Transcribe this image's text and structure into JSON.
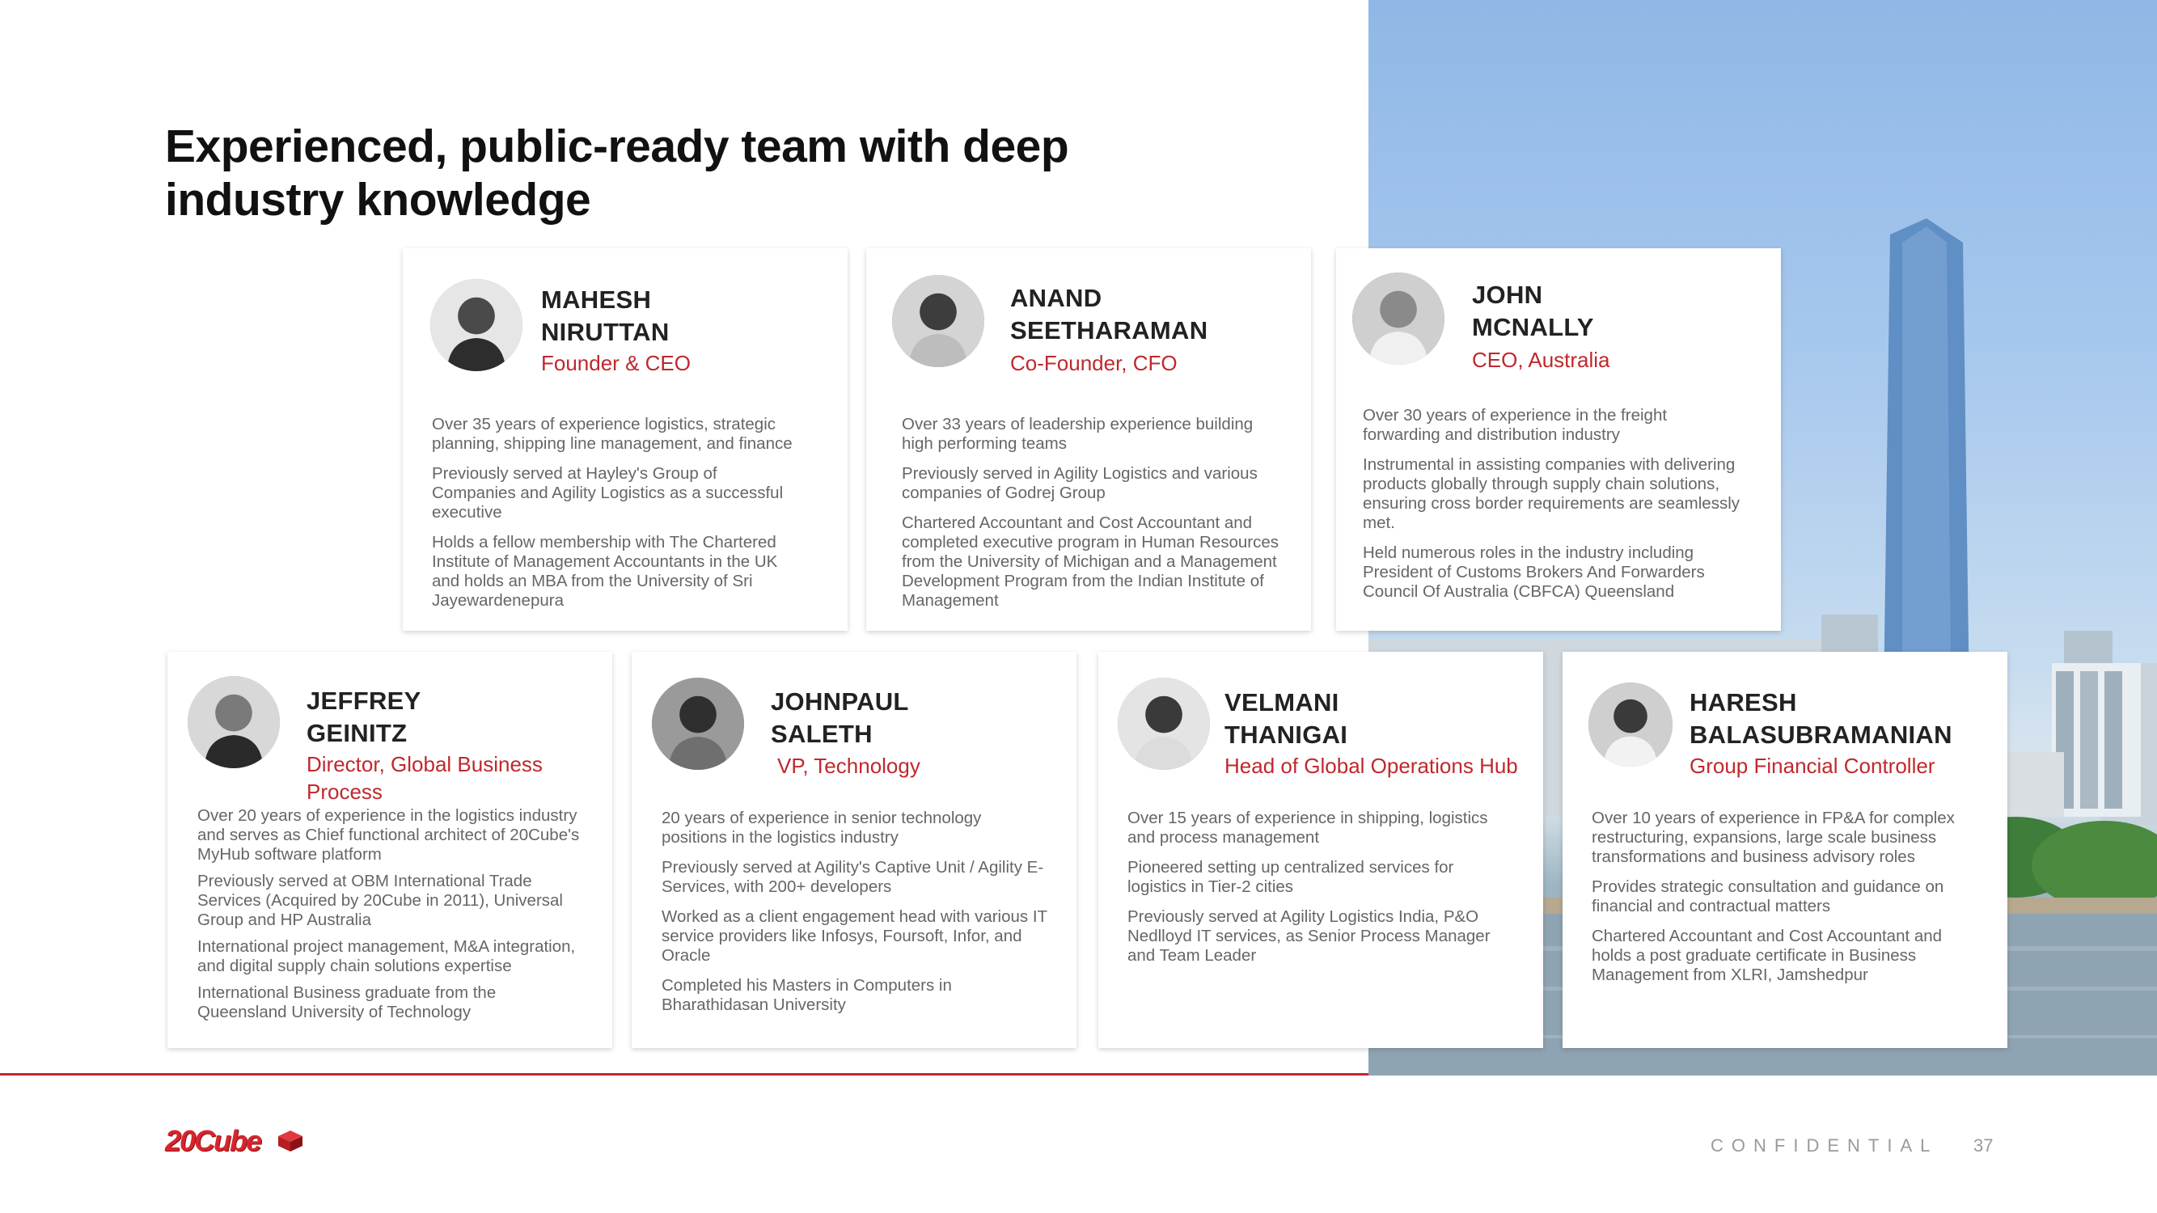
{
  "title": "Experienced, public-ready team with deep industry knowledge",
  "team": [
    {
      "name_line1": "MAHESH",
      "name_line2": "NIRUTTAN",
      "role": "Founder & CEO",
      "bullets": [
        "Over 35 years of experience logistics, strategic planning, shipping line management, and finance",
        "Previously served at Hayley's Group of Companies and Agility Logistics as a successful executive",
        "Holds a fellow membership with The Chartered Institute of Management Accountants in the UK and holds an MBA from the University of Sri Jayewardenepura"
      ]
    },
    {
      "name_line1": "ANAND",
      "name_line2": "SEETHARAMAN",
      "role": "Co-Founder, CFO",
      "bullets": [
        "Over 33 years of leadership experience building high performing teams",
        "Previously served in Agility Logistics and various companies of Godrej Group",
        "Chartered Accountant and Cost Accountant and completed executive program in Human Resources from the University of Michigan and a Management Development Program from the Indian Institute of Management"
      ]
    },
    {
      "name_line1": "JOHN",
      "name_line2": "MCNALLY",
      "role": "CEO, Australia",
      "bullets": [
        "Over 30 years of experience in the freight forwarding and distribution industry",
        "Instrumental in assisting companies with delivering products globally through supply chain solutions, ensuring cross border requirements are seamlessly met.",
        "Held numerous roles in the industry including President of Customs Brokers And Forwarders Council Of Australia (CBFCA) Queensland"
      ]
    },
    {
      "name_line1": "JEFFREY",
      "name_line2": "GEINITZ",
      "role": "Director, Global Business Process",
      "bullets": [
        "Over 20 years of experience in the logistics industry and serves as Chief functional architect of 20Cube's MyHub software platform",
        "Previously served at OBM International Trade Services (Acquired by 20Cube in 2011), Universal Group and HP Australia",
        "International project management, M&A integration, and digital supply chain solutions expertise",
        "International Business graduate from the Queensland University of Technology"
      ]
    },
    {
      "name_line1": "JOHNPAUL",
      "name_line2": "SALETH",
      "role": "VP, Technology",
      "bullets": [
        "20 years of experience in senior technology positions in the logistics industry",
        "Previously served at Agility's Captive Unit / Agility E-Services, with 200+ developers",
        "Worked as a client engagement head with various IT service providers like Infosys, Foursoft, Infor, and Oracle",
        "Completed his Masters in Computers in Bharathidasan University"
      ]
    },
    {
      "name_line1": "VELMANI",
      "name_line2": "THANIGAI",
      "role": "Head of Global Operations Hub",
      "bullets": [
        "Over 15 years of experience in shipping, logistics and process management",
        "Pioneered setting up centralized services for logistics in Tier-2 cities",
        "Previously served at Agility Logistics India, P&O Nedlloyd IT services, as Senior Process Manager and Team Leader"
      ]
    },
    {
      "name_line1": "HARESH",
      "name_line2": "BALASUBRAMANIAN",
      "role": "Group Financial Controller",
      "bullets": [
        "Over 10 years of experience in FP&A for complex restructuring, expansions, large scale business transformations and business advisory roles",
        "Provides strategic consultation and guidance on financial and contractual matters",
        "Chartered Accountant and Cost Accountant and holds a post graduate certificate in Business Management from XLRI, Jamshedpur"
      ]
    }
  ],
  "footer": {
    "logo_text": "20Cube",
    "confidential": "CONFIDENTIAL",
    "page_number": "37"
  },
  "colors": {
    "accent_red": "#c0282d",
    "body_gray": "#666666"
  }
}
